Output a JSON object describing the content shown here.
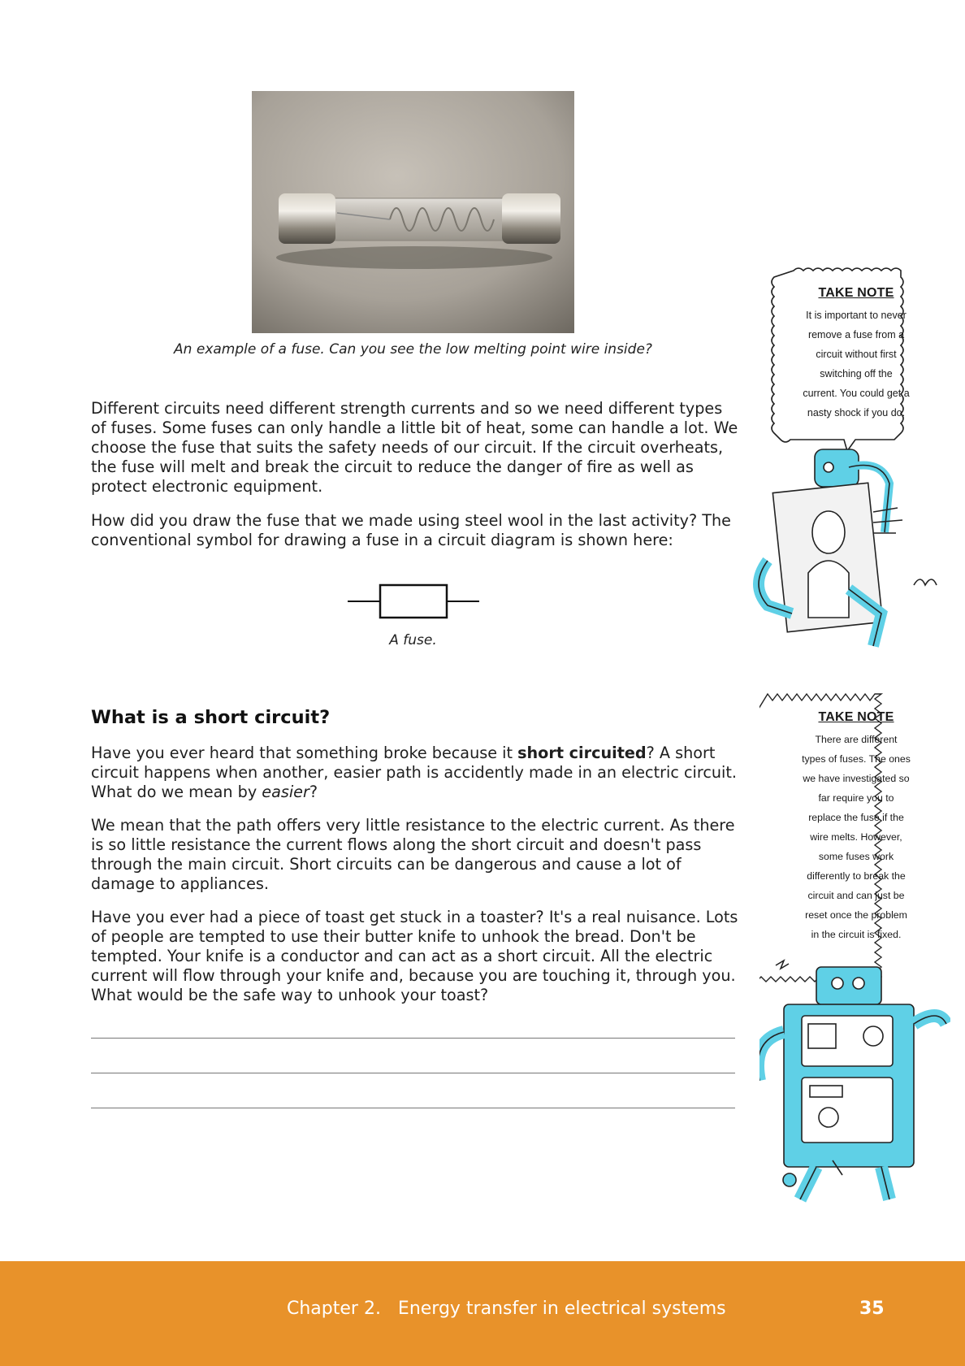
{
  "figure1": {
    "caption": "An example of a fuse. Can you see the low melting point wire inside?"
  },
  "paragraphs": {
    "p1": "Different circuits need different strength currents and so we need different types of fuses. Some fuses can only handle a little bit of heat, some can handle a lot. We choose the fuse that suits the safety needs of our circuit. If the circuit overheats, the fuse will melt and break the circuit to reduce the danger of fire as well as protect electronic equipment.",
    "p2": "How did you draw the fuse that we made using steel wool in the last activity? The conventional symbol for drawing a fuse in a circuit diagram is shown here:"
  },
  "figure2": {
    "caption": "A fuse."
  },
  "section": {
    "heading": "What is a short circuit?",
    "p3_part1": "Have you ever heard that something broke because it ",
    "p3_bold": "short circuited",
    "p3_part2": "? A short circuit happens when another, easier path is accidently made in an electric circuit. What do we mean by ",
    "p3_italic": "easier",
    "p3_part3": "?",
    "p4": "We mean that the path offers very little resistance to the electric current. As there is so little resistance the current flows along the short circuit and doesn't pass through the main circuit. Short circuits can be dangerous and cause a lot of damage to appliances.",
    "p5": "Have you ever had a piece of toast get stuck in a toaster? It's a real nuisance. Lots of people are tempted to use their butter knife to unhook the bread. Don't be tempted. Your knife is a conductor and can act as a short circuit. All the electric current will flow through your knife and, because you are touching it, through you. What would be the safe way to unhook your toast?"
  },
  "notes": [
    {
      "title": "TAKE NOTE",
      "lines": [
        "It is important to never",
        "remove a fuse from a",
        "circuit without first",
        "switching off the",
        "current. You could get a",
        "nasty shock if you do."
      ]
    },
    {
      "title": "TAKE NOTE",
      "lines": [
        "There are different",
        "types of fuses. The ones",
        "we have investigated so",
        "far require you to",
        "replace the fuse if the",
        "wire melts. However,",
        "some fuses work",
        "differently to break the",
        "circuit and can just be",
        "reset once the problem",
        "in the circuit is fixed."
      ]
    }
  ],
  "footer": {
    "chapter": "Chapter 2.   Energy transfer in electrical systems",
    "page": "35"
  },
  "colors": {
    "footer_bg": "#e8922a",
    "robot_accent": "#5fd0e6"
  }
}
